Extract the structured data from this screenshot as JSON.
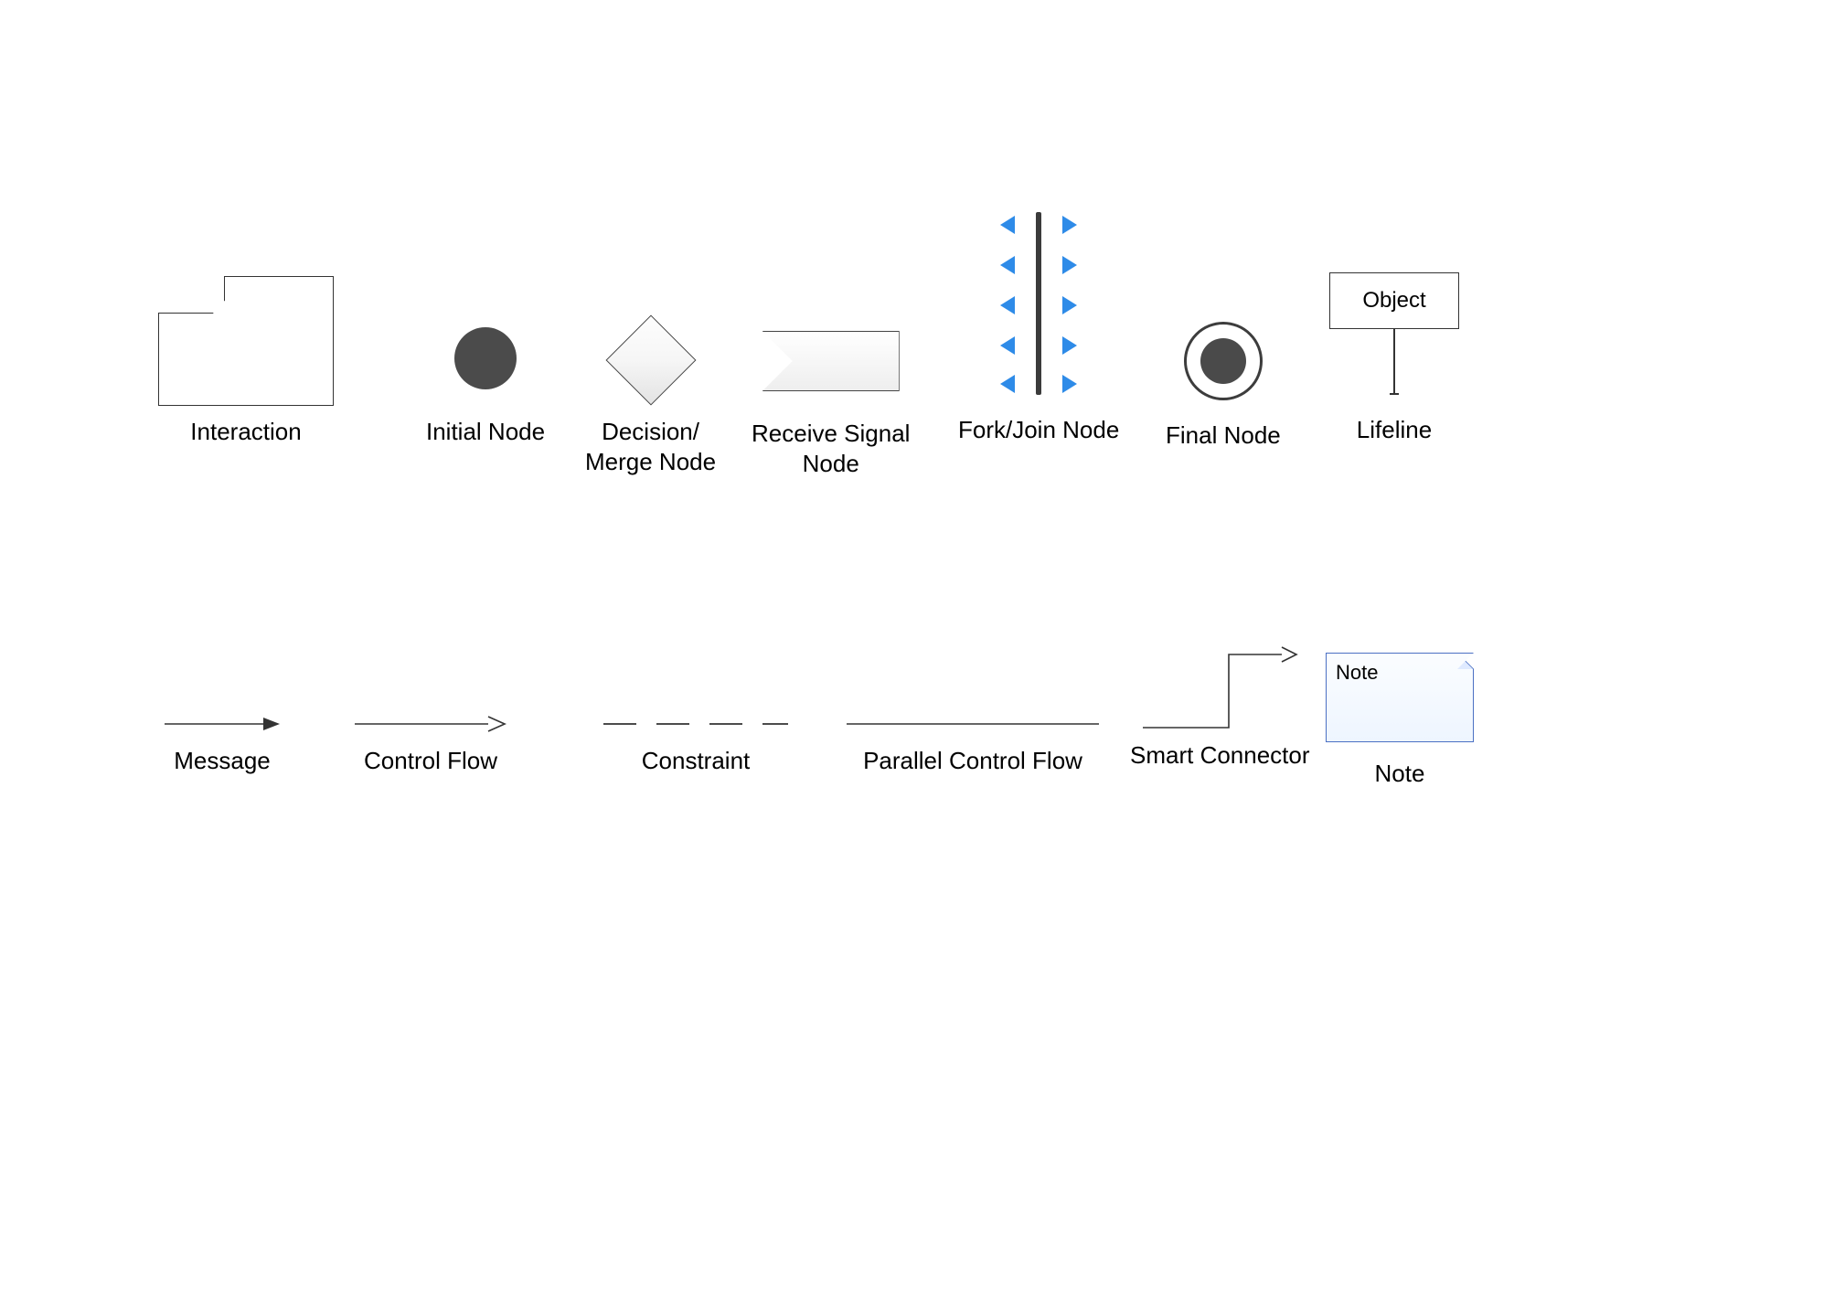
{
  "row1": {
    "interaction": "Interaction",
    "initial": "Initial Node",
    "decision": "Decision/\nMerge Node",
    "receive": "Receive Signal\nNode",
    "forkjoin": "Fork/Join Node",
    "final": "Final Node",
    "lifeline_label": "Lifeline",
    "lifeline_box": "Object"
  },
  "row2": {
    "message": "Message",
    "control": "Control Flow",
    "constraint": "Constraint",
    "parallel": "Parallel Control Flow",
    "smart": "Smart Connector",
    "note_label": "Note",
    "note_box": "Note"
  },
  "colors": {
    "accent_blue": "#2e8be8",
    "note_border": "#4b70c3",
    "dark_fill": "#4b4b4b"
  }
}
